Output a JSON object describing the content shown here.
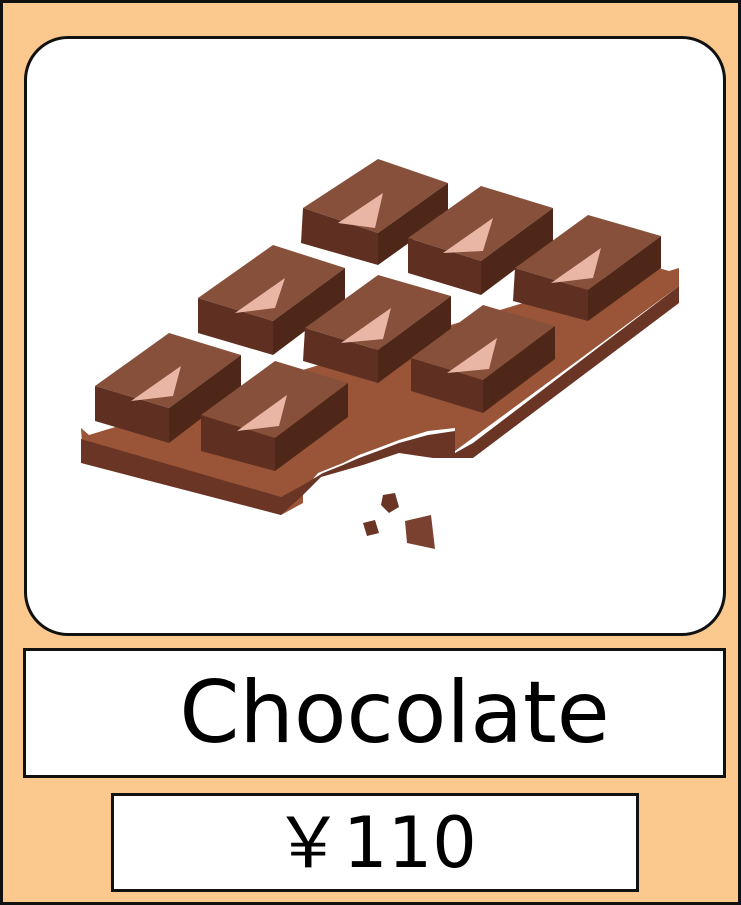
{
  "product": {
    "name": "Chocolate",
    "price": "￥110",
    "image_icon": "chocolate-bar-icon"
  },
  "colors": {
    "card_background": "#FBC88E",
    "border": "#111111",
    "chocolate_base": "#9A5538",
    "chocolate_top": "#87503A",
    "chocolate_side": "#5F3021",
    "chocolate_highlight": "#E9B6A6"
  }
}
